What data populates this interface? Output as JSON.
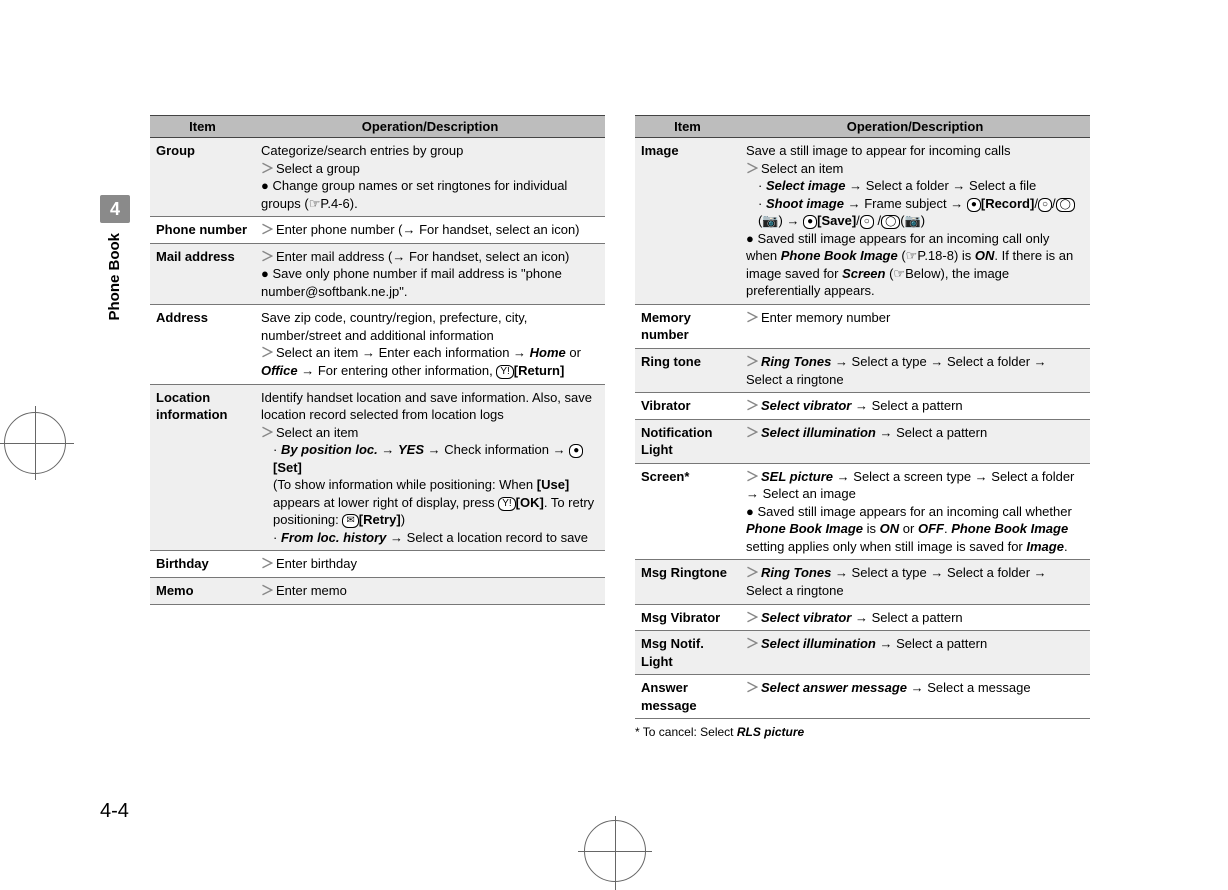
{
  "page_number": "4-4",
  "sidebar": {
    "chapter": "4",
    "label": "Phone Book"
  },
  "headers": {
    "item": "Item",
    "op": "Operation/Description"
  },
  "left": [
    {
      "item": "Group",
      "stripe": true,
      "lines": [
        "Categorize/search entries by group",
        "＞Select a group",
        "● Change group names or set ringtones for individual groups (☞P.4-6)."
      ]
    },
    {
      "item": "Phone number",
      "stripe": false,
      "lines": [
        "＞Enter phone number (→ For handset, select an icon)"
      ]
    },
    {
      "item": "Mail address",
      "stripe": true,
      "lines": [
        "＞Enter mail address (→ For handset, select an icon)",
        "● Save only phone number if mail address is \"phone number@softbank.ne.jp\"."
      ]
    },
    {
      "item": "Address",
      "stripe": false,
      "lines": [
        "Save zip code, country/region, prefecture, city, number/street and additional information",
        "＞Select an item → Enter each information → <bi>Home</bi> or <bi>Office</bi> → For entering other information, <key>Y!</key><b>[Return]</b>"
      ]
    },
    {
      "item": "Location information",
      "stripe": true,
      "lines": [
        "Identify handset location and save information. Also, save location record selected from location logs",
        "＞Select an item",
        "<sub>· <bi>By position loc.</bi> → <bi>YES</bi> → Check information → <key>●</key><b>[Set]</b></sub>",
        "<sub>(To show information while positioning: When <b>[Use]</b> appears at lower right of display, press <key>Y!</key><b>[OK]</b>. To retry positioning: <key>✉</key><b>[Retry]</b>)</sub>",
        "<sub>· <bi>From loc. history</bi> → Select a location record to save</sub>"
      ]
    },
    {
      "item": "Birthday",
      "stripe": false,
      "lines": [
        "＞Enter birthday"
      ]
    },
    {
      "item": "Memo",
      "stripe": true,
      "lines": [
        "＞Enter memo"
      ]
    }
  ],
  "right": [
    {
      "item": "Image",
      "stripe": true,
      "lines": [
        "Save a still image to appear for incoming calls",
        "＞Select an item",
        "<sub>· <bi>Select image</bi> → Select a folder → Select a file</sub>",
        "<sub>· <bi>Shoot image</bi> → Frame subject → <key>●</key><b>[Record]</b>/<key>○</key>/<key>◯</key>(📷) → <key>●</key><b>[Save]</b>/<key>○</key> /<key>◯</key>(📷)</sub>",
        "● Saved still image appears for an incoming call only when <bi>Phone Book Image</bi> (☞P.18-8) is <bi>ON</bi>. If there is an image saved for <bi>Screen</bi> (☞Below), the image preferentially appears."
      ]
    },
    {
      "item": "Memory number",
      "stripe": false,
      "lines": [
        "＞Enter memory number"
      ]
    },
    {
      "item": "Ring tone",
      "stripe": true,
      "lines": [
        "＞<bi>Ring Tones</bi> → Select a type → Select a folder → Select a ringtone"
      ]
    },
    {
      "item": "Vibrator",
      "stripe": false,
      "lines": [
        "＞<bi>Select vibrator</bi> → Select a pattern"
      ]
    },
    {
      "item": "Notification Light",
      "stripe": true,
      "lines": [
        "＞<bi>Select illumination</bi> → Select a pattern"
      ]
    },
    {
      "item": "Screen*",
      "stripe": false,
      "lines": [
        "＞<bi>SEL picture</bi> → Select a screen type → Select a folder → Select an image",
        "● Saved still image appears for an incoming call whether <bi>Phone Book Image</bi> is <bi>ON</bi> or <bi>OFF</bi>. <bi>Phone Book Image</bi> setting applies only when still image is saved for <bi>Image</bi>."
      ]
    },
    {
      "item": "Msg Ringtone",
      "stripe": true,
      "lines": [
        "＞<bi>Ring Tones</bi> → Select a type → Select a folder → Select a ringtone"
      ]
    },
    {
      "item": "Msg Vibrator",
      "stripe": false,
      "lines": [
        "＞<bi>Select vibrator</bi> → Select a pattern"
      ]
    },
    {
      "item": "Msg Notif. Light",
      "stripe": true,
      "lines": [
        "＞<bi>Select illumination</bi> → Select a pattern"
      ]
    },
    {
      "item": "Answer message",
      "stripe": false,
      "lines": [
        "＞<bi>Select answer message</bi> → Select a message"
      ]
    }
  ],
  "footnote": "* To cancel: Select <bi>RLS picture</bi>"
}
